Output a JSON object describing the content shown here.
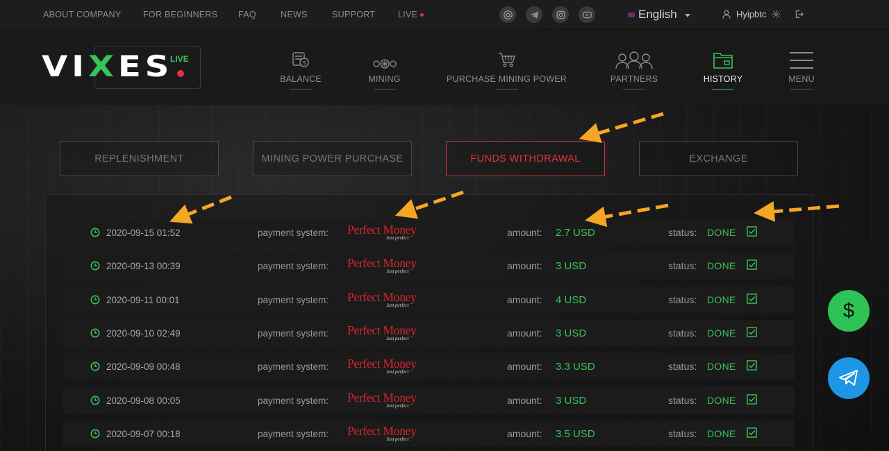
{
  "topnav": {
    "items": [
      "ABOUT COMPANY",
      "FOR BEGINNERS",
      "FAQ",
      "NEWS",
      "SUPPORT",
      "LIVE"
    ],
    "language": "English",
    "username": "Hyipbtc"
  },
  "brand": {
    "logo_prefix": "VI",
    "logo_x": "X",
    "logo_suffix": "ES",
    "live_label": "LIVE"
  },
  "mainnav": {
    "items": [
      "BALANCE",
      "MINING",
      "PURCHASE MINING POWER",
      "PARTNERS",
      "HISTORY",
      "MENU"
    ],
    "active": "HISTORY"
  },
  "tabs": {
    "items": [
      "REPLENISHMENT",
      "MINING POWER PURCHASE",
      "FUNDS WITHDRAWAL",
      "EXCHANGE"
    ],
    "active": "FUNDS WITHDRAWAL"
  },
  "history": {
    "payment_label": "payment system:",
    "amount_label": "amount:",
    "status_label": "status:",
    "payment_system_name": "Perfect Money",
    "payment_system_tagline": "Just perfect",
    "rows": [
      {
        "date": "2020-09-15 01:52",
        "amount": "2.7 USD",
        "status": "DONE"
      },
      {
        "date": "2020-09-13 00:39",
        "amount": "3 USD",
        "status": "DONE"
      },
      {
        "date": "2020-09-11 00:01",
        "amount": "4 USD",
        "status": "DONE"
      },
      {
        "date": "2020-09-10 02:49",
        "amount": "3 USD",
        "status": "DONE"
      },
      {
        "date": "2020-09-09 00:48",
        "amount": "3.3 USD",
        "status": "DONE"
      },
      {
        "date": "2020-09-08 00:05",
        "amount": "3 USD",
        "status": "DONE"
      },
      {
        "date": "2020-09-07 00:18",
        "amount": "3.5 USD",
        "status": "DONE"
      }
    ]
  },
  "floating": {
    "dollar_symbol": "$"
  },
  "colors": {
    "accent_green": "#37c35b",
    "accent_red": "#e5313f",
    "arrow_orange": "#f5a623",
    "telegram_blue": "#1d96e6"
  },
  "icons": [
    "clock-icon",
    "check-icon",
    "at-icon",
    "telegram-icon",
    "instagram-icon",
    "youtube-icon",
    "user-icon",
    "gear-icon",
    "logout-icon",
    "balance-icon",
    "mining-icon",
    "cart-icon",
    "partners-icon",
    "folder-icon",
    "hamburger-icon"
  ]
}
